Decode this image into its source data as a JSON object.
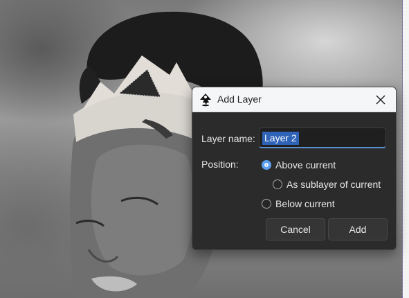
{
  "dialog": {
    "title": "Add Layer",
    "app_icon": "inkscape-icon",
    "close_icon": "close-icon",
    "layer_name_label": "Layer name:",
    "layer_name_value": "Layer 2",
    "position_label": "Position:",
    "position_options": [
      {
        "label": "Above current",
        "selected": true
      },
      {
        "label": "As sublayer of current",
        "selected": false
      },
      {
        "label": "Below current",
        "selected": false
      }
    ],
    "cancel_label": "Cancel",
    "add_label": "Add"
  },
  "colors": {
    "dialog_bg": "#2b2b2b",
    "titlebar_bg": "#f5f6f8",
    "selection": "#2e63b8",
    "accent": "#5a9ff2"
  }
}
